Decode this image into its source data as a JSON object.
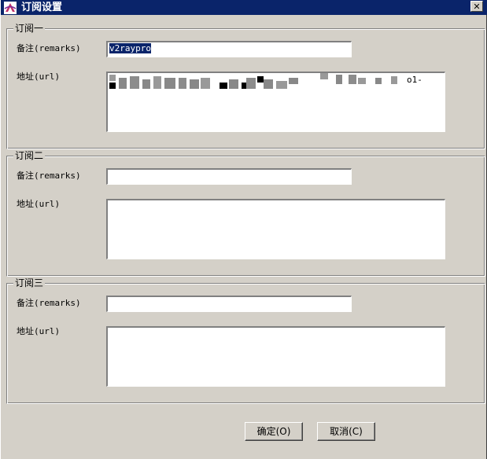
{
  "window": {
    "title": "订阅设置",
    "close_symbol": "✕",
    "colors": {
      "titlebar": "#0a246a",
      "face": "#d4d0c8",
      "selection": "#0a246a"
    }
  },
  "subscriptions": [
    {
      "group_title": "订阅一",
      "remarks_label": "备注(remarks)",
      "remarks_value": "v2raypro",
      "url_label": "地址(url)",
      "url_visible_tail": "o1-"
    },
    {
      "group_title": "订阅二",
      "remarks_label": "备注(remarks)",
      "remarks_value": "",
      "url_label": "地址(url)",
      "url_visible_tail": ""
    },
    {
      "group_title": "订阅三",
      "remarks_label": "备注(remarks)",
      "remarks_value": "",
      "url_label": "地址(url)",
      "url_visible_tail": ""
    }
  ],
  "buttons": {
    "ok": "确定(O)",
    "cancel": "取消(C)"
  },
  "icons": {
    "app": "v2ray-logo-icon",
    "close": "close-icon"
  }
}
